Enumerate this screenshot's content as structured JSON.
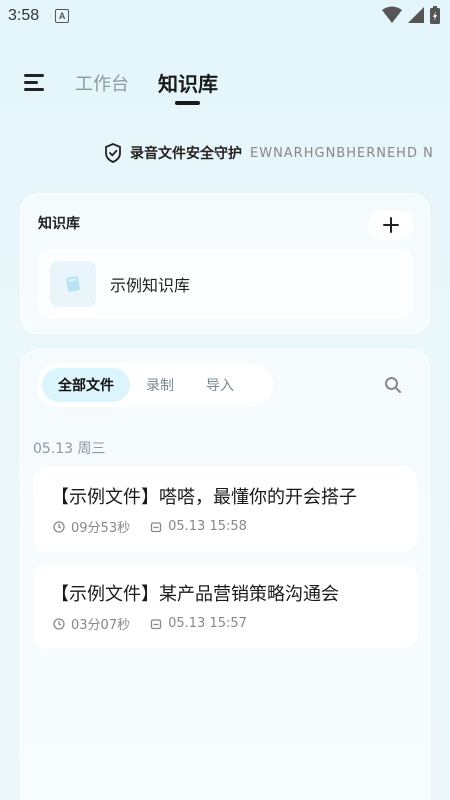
{
  "status_bar": {
    "time": "3:58",
    "notification_letter": "A"
  },
  "nav": {
    "tabs": [
      {
        "label": "工作台",
        "active": false
      },
      {
        "label": "知识库",
        "active": true
      }
    ]
  },
  "security_banner": {
    "text": "录音文件安全守护",
    "scroll_text": "EWNARHGNBHERNEHD N"
  },
  "knowledge_base": {
    "title": "知识库",
    "add_label": "+",
    "items": [
      {
        "name": "示例知识库"
      }
    ]
  },
  "files": {
    "filter_tabs": [
      {
        "label": "全部文件",
        "active": true
      },
      {
        "label": "录制",
        "active": false
      },
      {
        "label": "导入",
        "active": false
      }
    ],
    "groups": [
      {
        "date": "05.13 周三",
        "items": [
          {
            "title": "【示例文件】嗒嗒，最懂你的开会搭子",
            "duration": "09分53秒",
            "datetime": "05.13 15:58"
          },
          {
            "title": "【示例文件】某产品营销策略沟通会",
            "duration": "03分07秒",
            "datetime": "05.13 15:57"
          }
        ]
      }
    ]
  },
  "colors": {
    "accent_active_tab": "#dcf4fb",
    "background": "#e3f5fb"
  }
}
